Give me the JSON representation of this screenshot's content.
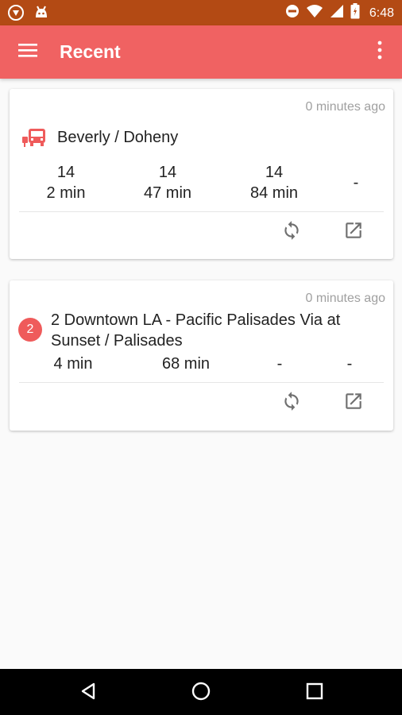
{
  "status_bar": {
    "time": "6:48"
  },
  "app_bar": {
    "title": "Recent"
  },
  "cards": [
    {
      "timestamp": "0 minutes ago",
      "stop_name": "Beverly / Doheny",
      "arrivals": [
        {
          "route": "14",
          "time": "2 min"
        },
        {
          "route": "14",
          "time": "47 min"
        },
        {
          "route": "14",
          "time": "84 min"
        },
        {
          "route": "",
          "time": "-"
        }
      ]
    },
    {
      "timestamp": "0 minutes ago",
      "route_badge": "2",
      "route_name": "2 Downtown LA - Pacific Palisades Via at Sunset / Palisades",
      "arrivals": [
        {
          "time": "4 min"
        },
        {
          "time": "68 min"
        },
        {
          "time": "-"
        },
        {
          "time": "-"
        }
      ]
    }
  ],
  "colors": {
    "accent": "#f06262",
    "status_bar": "#b34a14",
    "badge": "#ef5b5b"
  },
  "icons": {
    "menu": "menu-icon",
    "overflow": "more-vert-icon",
    "stop": "bus-stop-icon",
    "refresh": "refresh-icon",
    "open": "open-in-new-icon"
  }
}
